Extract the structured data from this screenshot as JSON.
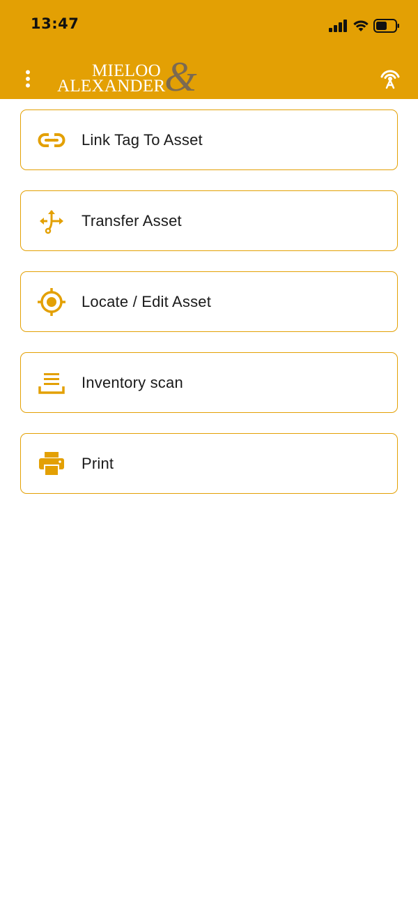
{
  "status_bar": {
    "time": "13:47"
  },
  "header": {
    "background_color": "#E3A004",
    "menu_icon": "more-vertical-icon",
    "logo": {
      "line1": "MIELOO",
      "line2": "ALEXANDER",
      "ampersand": "&"
    },
    "nfc_icon": "nfc-antenna-icon"
  },
  "menu": {
    "accent_color": "#E3A004",
    "items": [
      {
        "label": "Link Tag To Asset",
        "icon": "link-icon"
      },
      {
        "label": "Transfer Asset",
        "icon": "transfer-icon"
      },
      {
        "label": "Locate / Edit Asset",
        "icon": "target-icon"
      },
      {
        "label": "Inventory scan",
        "icon": "inventory-icon"
      },
      {
        "label": "Print",
        "icon": "printer-icon"
      }
    ]
  }
}
